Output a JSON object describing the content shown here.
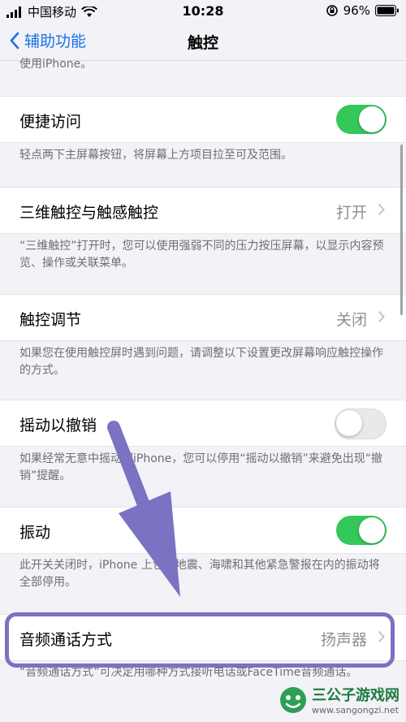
{
  "status": {
    "carrier": "中国移动",
    "time": "10:28",
    "battery": "96%"
  },
  "nav": {
    "back_label": "辅助功能",
    "title": "触控"
  },
  "prev_note": "使用iPhone。",
  "sections": {
    "reachability": {
      "label": "便捷访问",
      "toggle_on": true,
      "note": "轻点两下主屏幕按钮，将屏幕上方项目拉至可及范围。"
    },
    "touch3d": {
      "label": "三维触控与触感触控",
      "value": "打开",
      "note": "“三维触控”打开时，您可以使用强弱不同的压力按压屏幕，以显示内容预览、操作或关联菜单。"
    },
    "touch_accommodations": {
      "label": "触控调节",
      "value": "关闭",
      "note": "如果您在使用触控屏时遇到问题，请调整以下设置更改屏幕响应触控操作的方式。"
    },
    "shake_to_undo": {
      "label": "摇动以撤销",
      "toggle_on": false,
      "note": "如果经常无意中摇动到iPhone，您可以停用“摇动以撤销”来避免出现“撤销”提醒。"
    },
    "vibration": {
      "label": "振动",
      "toggle_on": true,
      "note": "此开关关闭时，iPhone 上包括地震、海啸和其他紧急警报在内的振动将全部停用。"
    },
    "call_audio_routing": {
      "label": "音频通话方式",
      "value": "扬声器",
      "note": "“音频通话方式”可决定用哪种方式接听电话或FaceTime音频通话。"
    }
  },
  "watermark": {
    "title": "三公子游戏网",
    "url": "www.sangongzi.net"
  },
  "colors": {
    "accent": "#1a73e8",
    "toggle_on": "#34c759",
    "annotation": "#7a72c2"
  }
}
